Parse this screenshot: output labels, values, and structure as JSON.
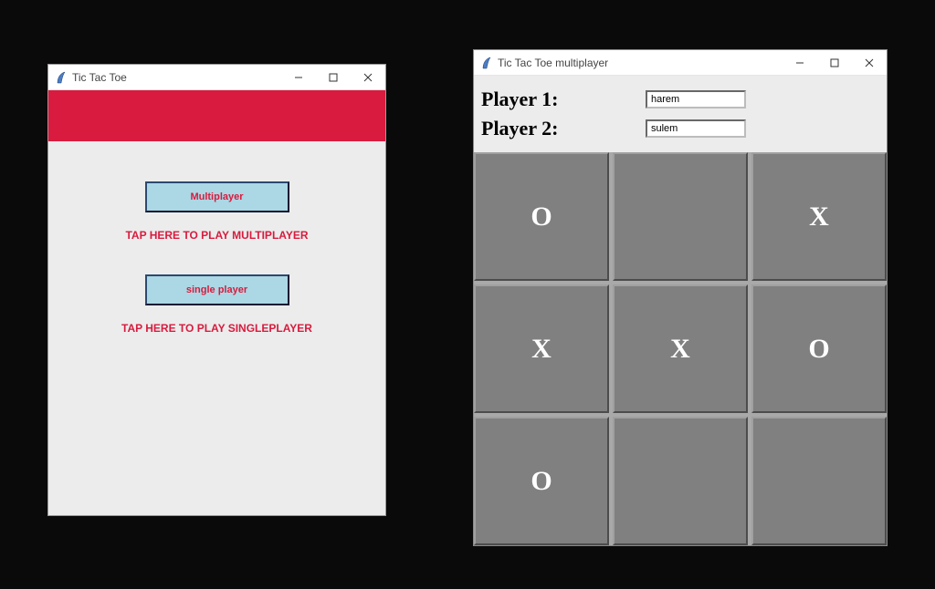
{
  "window1": {
    "title": "Tic Tac Toe",
    "buttons": {
      "multiplayer": {
        "label": "Multiplayer",
        "caption": "TAP HERE TO PLAY MULTIPLAYER"
      },
      "singleplayer": {
        "label": "single player",
        "caption": "TAP HERE TO PLAY SINGLEPLAYER"
      }
    }
  },
  "window2": {
    "title": "Tic Tac Toe multiplayer",
    "player1_label": "Player 1:",
    "player2_label": "Player 2:",
    "player1_value": "harem",
    "player2_value": "sulem",
    "grid": [
      [
        "O",
        "",
        "X"
      ],
      [
        "X",
        "X",
        "O"
      ],
      [
        "O",
        "",
        ""
      ]
    ]
  }
}
